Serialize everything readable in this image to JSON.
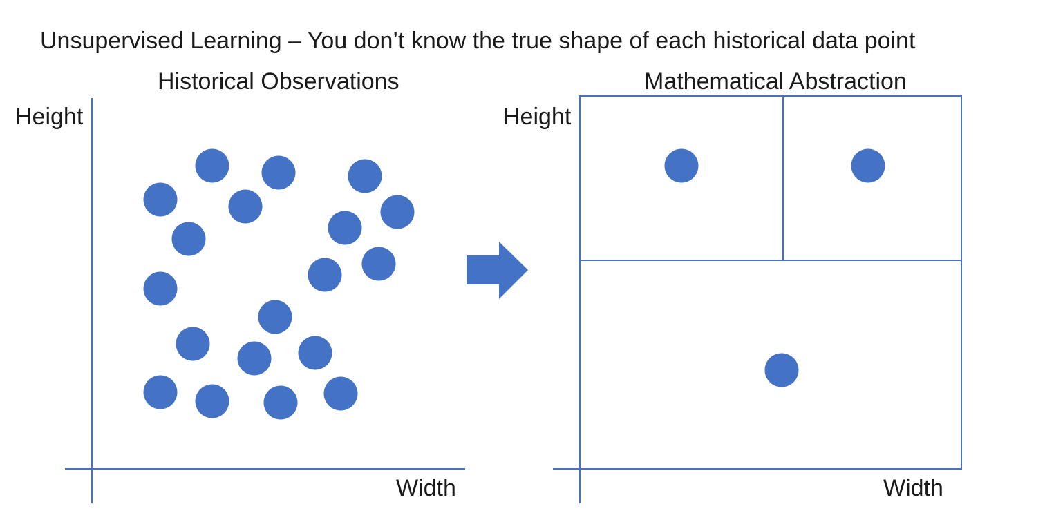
{
  "title": "Unsupervised Learning – You don’t know the true shape of each historical data point",
  "left_panel": {
    "title": "Historical Observations",
    "ylabel": "Height",
    "xlabel": "Width"
  },
  "right_panel": {
    "title": "Mathematical Abstraction",
    "ylabel": "Height",
    "xlabel": "Width"
  },
  "arrow": {
    "icon": "right-arrow-icon"
  },
  "colors": {
    "point": "#4472C4",
    "axis": "#4472C4",
    "text": "#1a1a1a"
  }
}
